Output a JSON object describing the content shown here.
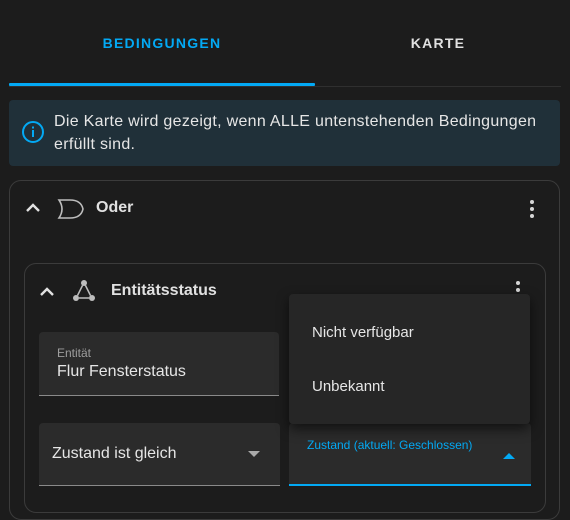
{
  "tabs": [
    {
      "label": "BEDINGUNGEN",
      "active": true
    },
    {
      "label": "KARTE",
      "active": false
    }
  ],
  "alert": {
    "icon": "info-icon",
    "text": "Die Karte wird gezeigt, wenn ALLE untenstehenden Bedingungen erfüllt sind."
  },
  "or_condition": {
    "title": "Oder",
    "icon": "or-gate-icon"
  },
  "entity_condition": {
    "title": "Entitätsstatus",
    "icon": "state-machine-icon",
    "entity_field": {
      "label": "Entität",
      "value": "Flur Fensterstatus"
    },
    "state_mode_field": {
      "value": "Zustand ist gleich"
    },
    "state_field": {
      "label": "Zustand (aktuell: Geschlossen)"
    }
  },
  "dropdown": {
    "options": [
      "Nicht verfügbar",
      "Unbekannt"
    ]
  },
  "colors": {
    "accent": "#03a9f4",
    "background": "#1c1c1c",
    "alert_background": "#203039",
    "field_background": "#2b2b2b"
  }
}
